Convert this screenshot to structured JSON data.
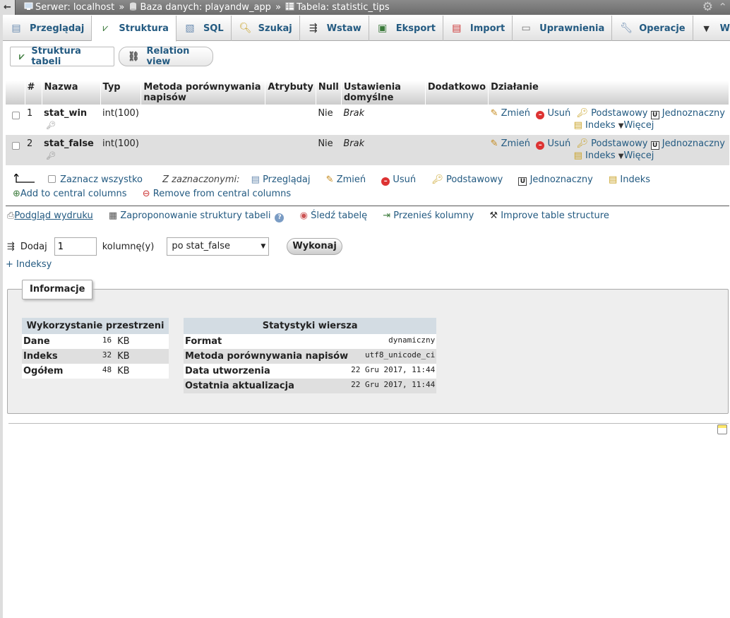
{
  "breadcrumb": {
    "back": "←",
    "server": "Serwer: localhost",
    "sep1": "»",
    "database": "Baza danych: playandw_app",
    "sep2": "»",
    "table": "Tabela: statistic_tips"
  },
  "tabs": [
    {
      "label": "Przeglądaj",
      "icon": "browse-icon"
    },
    {
      "label": "Struktura",
      "icon": "structure-icon"
    },
    {
      "label": "SQL",
      "icon": "sql-icon"
    },
    {
      "label": "Szukaj",
      "icon": "search-icon"
    },
    {
      "label": "Wstaw",
      "icon": "insert-icon"
    },
    {
      "label": "Eksport",
      "icon": "export-icon"
    },
    {
      "label": "Import",
      "icon": "import-icon"
    },
    {
      "label": "Uprawnienia",
      "icon": "privileges-icon"
    },
    {
      "label": "Operacje",
      "icon": "wrench-icon"
    },
    {
      "label": "Więcej",
      "icon": "triangle-down-icon"
    }
  ],
  "active_tab": "Struktura",
  "subtabs": {
    "structure": "Struktura tabeli",
    "relation": "Relation view"
  },
  "table": {
    "headers": {
      "num": "#",
      "name": "Nazwa",
      "type": "Typ",
      "collation": "Metoda porównywania napisów",
      "attributes": "Atrybuty",
      "null": "Null",
      "default": "Ustawienia domyślne",
      "extra": "Dodatkowo",
      "action": "Działanie"
    },
    "rows": [
      {
        "num": "1",
        "name": "stat_win",
        "type": "int(100)",
        "collation": "",
        "attributes": "",
        "null": "Nie",
        "default": "Brak",
        "extra": ""
      },
      {
        "num": "2",
        "name": "stat_false",
        "type": "int(100)",
        "collation": "",
        "attributes": "",
        "null": "Nie",
        "default": "Brak",
        "extra": ""
      }
    ],
    "actions": {
      "change": "Zmień",
      "drop": "Usuń",
      "primary": "Podstawowy",
      "unique": "Jednoznaczny",
      "index": "Indeks",
      "more": "Więcej"
    }
  },
  "bulk": {
    "check_all": "Zaznacz wszystko",
    "with_selected": "Z zaznaczonymi:",
    "browse": "Przeglądaj",
    "change": "Zmień",
    "drop": "Usuń",
    "primary": "Podstawowy",
    "unique": "Jednoznaczny",
    "index": "Indeks",
    "add_central": "Add to central columns",
    "remove_central": "Remove from central columns"
  },
  "links": {
    "print": "Podgląd wydruku",
    "propose": "Zaproponowanie struktury tabeli",
    "track": "Śledź tabelę",
    "move": "Przenieś kolumny",
    "improve": "Improve table structure"
  },
  "add_column": {
    "label_add": "Dodaj",
    "count": "1",
    "label_columns": "kolumnę(y)",
    "position": "po stat_false",
    "go": "Wykonaj"
  },
  "indexes_link": "+ Indeksy",
  "info": {
    "legend": "Informacje",
    "space": {
      "title": "Wykorzystanie przestrzeni",
      "rows": [
        {
          "label": "Dane",
          "value": "16",
          "unit": "KB"
        },
        {
          "label": "Indeks",
          "value": "32",
          "unit": "KB"
        },
        {
          "label": "Ogółem",
          "value": "48",
          "unit": "KB"
        }
      ]
    },
    "row_stats": {
      "title": "Statystyki wiersza",
      "rows": [
        {
          "label": "Format",
          "value": "dynamiczny"
        },
        {
          "label": "Metoda porównywania napisów",
          "value": "utf8_unicode_ci"
        },
        {
          "label": "Data utworzenia",
          "value": "22 Gru 2017, 11:44"
        },
        {
          "label": "Ostatnia aktualizacja",
          "value": "22 Gru 2017, 11:44"
        }
      ]
    }
  }
}
